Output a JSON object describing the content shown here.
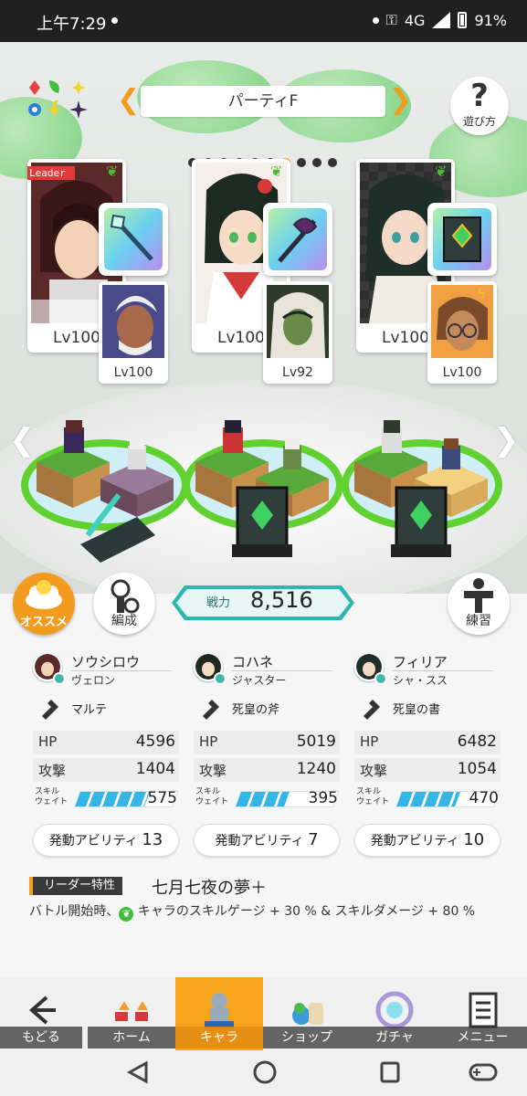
{
  "status_bar": {
    "time": "上午7:29",
    "network": "4G",
    "battery": "91%"
  },
  "party": {
    "name": "パーティF",
    "page_count": 10,
    "current_page": 7
  },
  "help": {
    "label": "遊び方"
  },
  "units": [
    {
      "leader_tag": "Leader",
      "main_level": "Lv100",
      "sub_level": "Lv100",
      "element": "leaf"
    },
    {
      "main_level": "Lv100",
      "sub_level": "Lv92",
      "element": "leaf"
    },
    {
      "main_level": "Lv100",
      "sub_level": "Lv100",
      "element": "leaf"
    }
  ],
  "buttons": {
    "recommend": "オススメ",
    "formation": "編成",
    "training": "練習"
  },
  "power": {
    "label": "戦力",
    "value": "8,516"
  },
  "characters": [
    {
      "name": "ソウシロウ",
      "sub": "ヴェロン",
      "weapon": "マルテ",
      "hp_label": "HP",
      "hp": "4596",
      "atk_label": "攻撃",
      "atk": "1404",
      "skill_label": "スキル ウェイト",
      "skill_wait": "575",
      "skill_fill": 0.72,
      "ability_label": "発動アビリティ",
      "ability_count": "13"
    },
    {
      "name": "コハネ",
      "sub": "ジャスター",
      "weapon": "死皇の斧",
      "hp_label": "HP",
      "hp": "5019",
      "atk_label": "攻撃",
      "atk": "1240",
      "skill_label": "スキル ウェイト",
      "skill_wait": "395",
      "skill_fill": 0.5,
      "ability_label": "発動アビリティ",
      "ability_count": "7"
    },
    {
      "name": "フィリア",
      "sub": "シャ・スス",
      "weapon": "死皇の書",
      "hp_label": "HP",
      "hp": "6482",
      "atk_label": "攻撃",
      "atk": "1054",
      "skill_label": "スキル ウェイト",
      "skill_wait": "470",
      "skill_fill": 0.6,
      "ability_label": "発動アビリティ",
      "ability_count": "10"
    }
  ],
  "leader_trait": {
    "tag": "リーダー特性",
    "name": "七月七夜の夢＋",
    "desc_a": "バトル開始時、",
    "desc_b": "キャラのスキルゲージ + 30 % & スキルダメージ + 80 %"
  },
  "nav": {
    "back": "もどる",
    "home": "ホーム",
    "chara": "キャラ",
    "shop": "ショップ",
    "gacha": "ガチャ",
    "menu": "メニュー"
  },
  "colors": {
    "accent": "#f29b1c",
    "leaf": "#4cbb33",
    "power": "#2bb8b0",
    "skill": "#34b6e4"
  }
}
